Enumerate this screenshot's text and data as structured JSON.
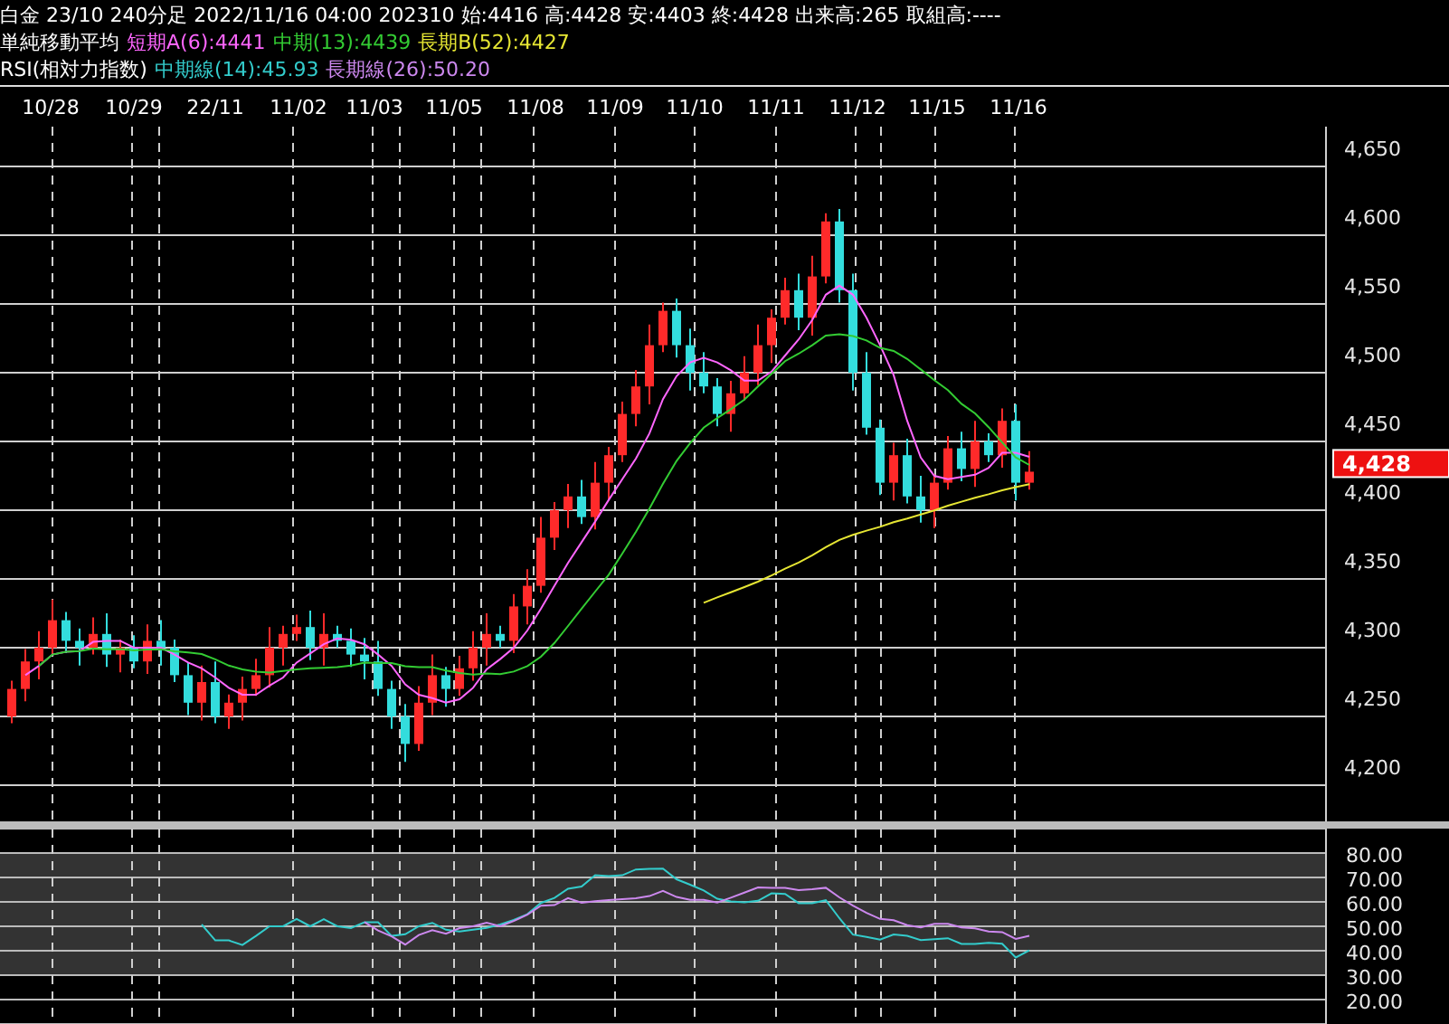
{
  "header": {
    "quote": "白金 23/10 240分足 2022/11/16 04:00 202310 始:4416 高:4428 安:4403 終:4428 出来高:265 取組高:----",
    "ma": {
      "label": "単純移動平均",
      "items": [
        {
          "text": "短期A(6):4441",
          "color": "#ff66ff"
        },
        {
          "text": "中期(13):4439",
          "color": "#33cc33"
        },
        {
          "text": "長期B(52):4427",
          "color": "#e6e633"
        }
      ]
    },
    "rsi": {
      "label": "RSI(相対力指数)",
      "items": [
        {
          "text": "中期線(14):45.93",
          "color": "#33cccc"
        },
        {
          "text": "長期線(26):50.20",
          "color": "#cc88ee"
        }
      ]
    }
  },
  "dates": [
    "10/28",
    "10/29",
    "22/11",
    "11/02",
    "11/03",
    "11/05",
    "11/08",
    "11/09",
    "11/10",
    "11/11",
    "11/12",
    "11/15",
    "11/16"
  ],
  "price_axis": [
    "4,650",
    "4,600",
    "4,550",
    "4,500",
    "4,450",
    "4,400",
    "4,350",
    "4,300",
    "4,250",
    "4,200"
  ],
  "current_price": "4,428",
  "rsi_axis": [
    "80.00",
    "70.00",
    "60.00",
    "50.00",
    "40.00",
    "30.00",
    "20.00"
  ]
}
